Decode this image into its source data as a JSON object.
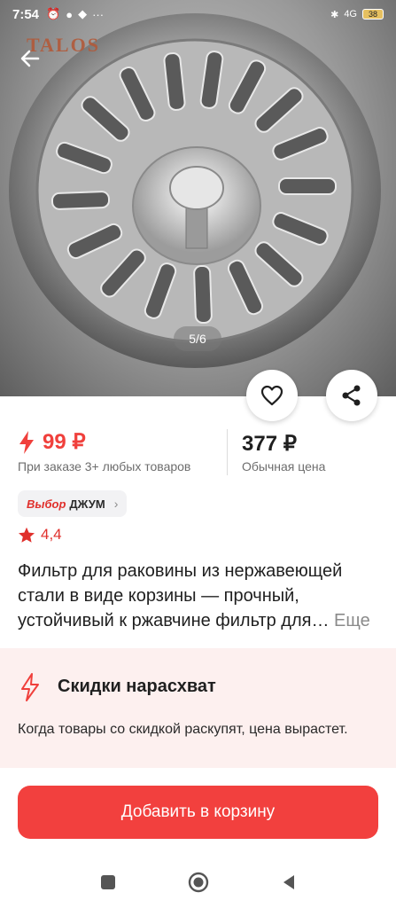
{
  "status_bar": {
    "time": "7:54",
    "network": "4G",
    "battery": "38"
  },
  "hero": {
    "watermark": "TALOS",
    "pager": "5/6"
  },
  "price": {
    "promo_value": "99 ₽",
    "promo_note": "При заказе 3+ любых товаров",
    "regular_value": "377 ₽",
    "regular_note": "Обычная цена"
  },
  "badge": {
    "brand": "Выбор",
    "label": "ДЖУМ"
  },
  "rating": {
    "value": "4,4"
  },
  "description": {
    "line1": "Фильтр для раковины из нержавеющей",
    "line2": "стали в виде корзины — прочный,",
    "line3": "устойчивый к ржавчине фильтр для…",
    "more": "Еще"
  },
  "deal": {
    "title": "Скидки нарасхват",
    "text": "Когда товары со скидкой раскупят, цена вырастет."
  },
  "cta": {
    "label": "Добавить в корзину"
  },
  "colors": {
    "accent": "#f2403e",
    "deal_bg": "#fdf0ef"
  },
  "icons": [
    "back-arrow-icon",
    "heart-icon",
    "share-icon",
    "bolt-icon",
    "star-icon",
    "chevron-right-icon",
    "nav-square-icon",
    "nav-circle-icon",
    "nav-back-icon"
  ]
}
